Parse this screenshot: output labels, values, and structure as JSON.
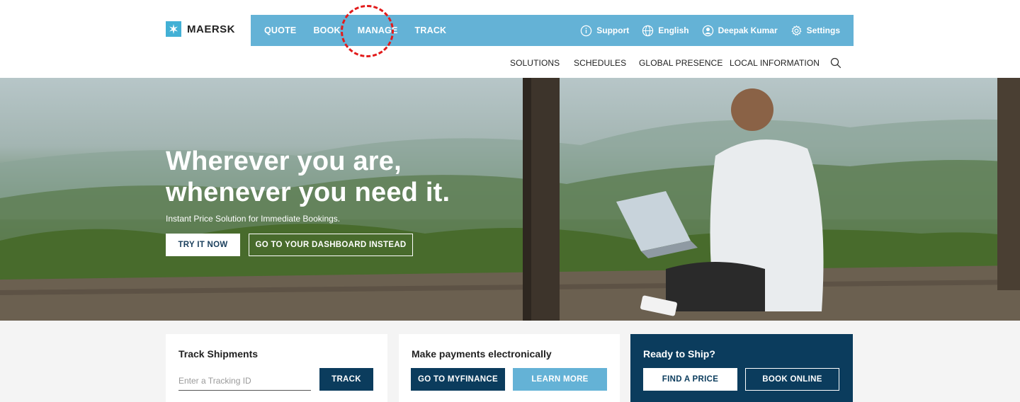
{
  "header": {
    "logo_text": "MAERSK",
    "primary_nav": [
      "QUOTE",
      "BOOK",
      "MANAGE",
      "TRACK"
    ],
    "utility": {
      "support": "Support",
      "language": "English",
      "user": "Deepak Kumar",
      "settings": "Settings"
    },
    "secondary_nav": [
      "SOLUTIONS",
      "SCHEDULES",
      "GLOBAL PRESENCE",
      "LOCAL INFORMATION"
    ],
    "highlighted_item": "MANAGE"
  },
  "hero": {
    "title_line1": "Wherever you are,",
    "title_line2": "whenever you need it.",
    "subtitle": "Instant Price Solution for Immediate Bookings.",
    "primary_button": "TRY IT NOW",
    "secondary_button": "GO TO YOUR DASHBOARD INSTEAD"
  },
  "cards": {
    "track": {
      "title": "Track Shipments",
      "input_placeholder": "Enter a Tracking ID",
      "button": "TRACK"
    },
    "payments": {
      "title": "Make payments electronically",
      "button_primary": "GO TO MYFINANCE",
      "button_secondary": "LEARN MORE"
    },
    "ship": {
      "title": "Ready to Ship?",
      "button_primary": "FIND A PRICE",
      "button_secondary": "BOOK ONLINE"
    }
  },
  "colors": {
    "brand_light_blue": "#64b2d6",
    "brand_dark_blue": "#0b3c5d",
    "highlight_red": "#e21b1b"
  },
  "icons": [
    "maersk-star-icon",
    "info-icon",
    "globe-icon",
    "user-icon",
    "gear-icon",
    "search-icon"
  ]
}
